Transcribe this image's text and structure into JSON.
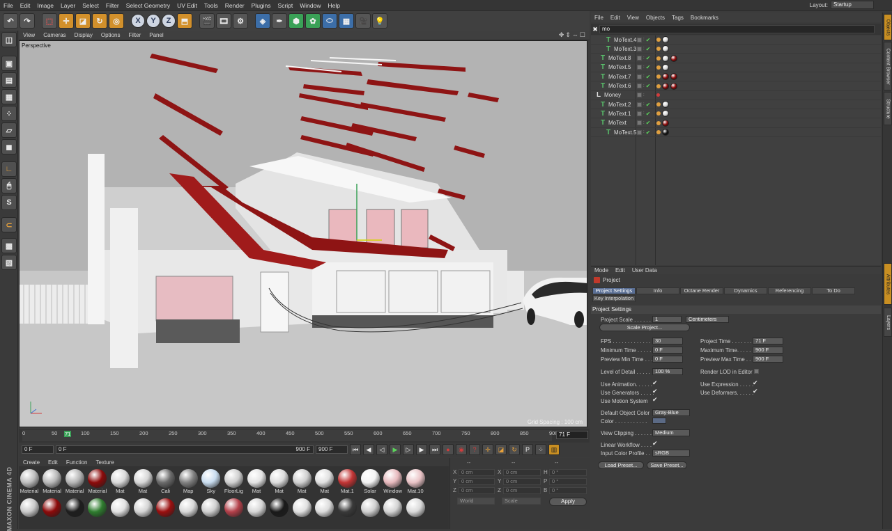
{
  "menubar": {
    "items": [
      "File",
      "Edit",
      "Image",
      "Layer",
      "Select",
      "Filter",
      "Select Geometry",
      "UV Edit",
      "Tools",
      "Render",
      "Plugins",
      "Script",
      "Window",
      "Help"
    ],
    "layout_label": "Layout:",
    "layout_value": "Startup"
  },
  "toolbar": {
    "axis_x": "X",
    "axis_y": "Y",
    "axis_z": "Z"
  },
  "leftpal": {
    "s_label": "S"
  },
  "brand": "MAXON CINEMA 4D",
  "viewport": {
    "menu": [
      "View",
      "Cameras",
      "Display",
      "Options",
      "Filter",
      "Panel"
    ],
    "nav_icons": "✥⇕⇔☐",
    "label": "Perspective",
    "grid_spacing": "Grid Spacing : 100 cm"
  },
  "timeline": {
    "ticks": [
      "0",
      "50",
      "100",
      "150",
      "200",
      "250",
      "300",
      "350",
      "400",
      "450",
      "500",
      "550",
      "600",
      "650",
      "700",
      "750",
      "800",
      "850",
      "900"
    ],
    "current_marker": "71",
    "frame_field": "71 F"
  },
  "transport": {
    "start": "0 F",
    "range_start": "0 F",
    "range_end": "900 F",
    "end": "900 F"
  },
  "materials": {
    "menu": [
      "Create",
      "Edit",
      "Function",
      "Texture"
    ],
    "row1": [
      {
        "label": "Material",
        "color": "#bdbdbd"
      },
      {
        "label": "Material",
        "color": "#b8b8b8"
      },
      {
        "label": "Material",
        "color": "#b5b5b5"
      },
      {
        "label": "Material",
        "color": "#8c0a0a"
      },
      {
        "label": "Mat",
        "color": "#d9d9d9"
      },
      {
        "label": "Mat",
        "color": "#d6d6d6"
      },
      {
        "label": "Cali",
        "color": "#6a6a6a"
      },
      {
        "label": "Map",
        "color": "#808080"
      },
      {
        "label": "Sky",
        "color": "#c8dcef"
      },
      {
        "label": "FloorLig",
        "color": "#cfcfcf"
      },
      {
        "label": "Mat",
        "color": "#e4e4e4"
      },
      {
        "label": "Mat",
        "color": "#dcdcdc"
      },
      {
        "label": "Mat",
        "color": "#d0d0d0"
      },
      {
        "label": "Mat",
        "color": "#e0e0e0"
      },
      {
        "label": "Mat.1",
        "color": "#c23434"
      },
      {
        "label": "Solar",
        "color": "#f2f2f2"
      },
      {
        "label": "Window",
        "color": "#e7b9bd"
      },
      {
        "label": "Mat.10",
        "color": "#e9c3c6"
      }
    ],
    "row2": [
      {
        "color": "#c9c9c9"
      },
      {
        "color": "#8c0a0a"
      },
      {
        "color": "#1e1e1e"
      },
      {
        "color": "#2f7d2f"
      },
      {
        "color": "#e1e1e1"
      },
      {
        "color": "#d4d4d4"
      },
      {
        "color": "#9a0f0f"
      },
      {
        "color": "#d8d8d8"
      },
      {
        "color": "#cfcfcf"
      },
      {
        "color": "#b3404a"
      },
      {
        "color": "#d6d6d6"
      },
      {
        "color": "#1a1a1a"
      },
      {
        "color": "#e0e0e0"
      },
      {
        "color": "#dcdcdc"
      },
      {
        "color": "#3a3a3a"
      },
      {
        "color": "#cfcfcf"
      },
      {
        "color": "#d3d3d3"
      },
      {
        "color": "#d9d9d9"
      }
    ]
  },
  "coords": {
    "headers": [
      "--",
      "--",
      "--"
    ],
    "rows": [
      {
        "a": "X",
        "av": "0 cm",
        "b": "X",
        "bv": "0 cm",
        "c": "H",
        "cv": "0 °"
      },
      {
        "a": "Y",
        "av": "0 cm",
        "b": "Y",
        "bv": "0 cm",
        "c": "P",
        "cv": "0 °"
      },
      {
        "a": "Z",
        "av": "0 cm",
        "b": "Z",
        "bv": "0 cm",
        "c": "B",
        "cv": "0 °"
      }
    ],
    "world": "World",
    "scale": "Scale",
    "apply": "Apply"
  },
  "objects": {
    "menu": [
      "File",
      "Edit",
      "View",
      "Objects",
      "Tags",
      "Bookmarks"
    ],
    "search_value": "mo",
    "rows": [
      {
        "name": "MoText.4",
        "indent": 22,
        "tag": "#d8d8d8",
        "extra": ""
      },
      {
        "name": "MoText.3",
        "indent": 22,
        "tag": "#d8d8d8",
        "extra": ""
      },
      {
        "name": "MoText.8",
        "indent": 14,
        "tag": "#d8d8d8",
        "extra": "#8c0a0a"
      },
      {
        "name": "MoText.5",
        "indent": 14,
        "tag": "#d8d8d8",
        "extra": ""
      },
      {
        "name": "MoText.7",
        "indent": 14,
        "tag": "#8c0a0a",
        "extra": "#8c0a0a"
      },
      {
        "name": "MoText.6",
        "indent": 14,
        "tag": "#8c0a0a",
        "extra": "#8c0a0a"
      },
      {
        "name": "Money",
        "indent": 8,
        "tag": "",
        "extra": ""
      },
      {
        "name": "MoText.2",
        "indent": 14,
        "tag": "#d8d8d8",
        "extra": ""
      },
      {
        "name": "MoText.1",
        "indent": 14,
        "tag": "#d8d8d8",
        "extra": ""
      },
      {
        "name": "MoText",
        "indent": 14,
        "tag": "#8c0a0a",
        "extra": ""
      },
      {
        "name": "MoText.5",
        "indent": 22,
        "tag": "#111111",
        "extra": ""
      }
    ]
  },
  "rtabs": [
    "Objects",
    "Content Browser",
    "Structure",
    "Attributes",
    "Layers"
  ],
  "attributes": {
    "menu": [
      "Mode",
      "Edit",
      "User Data"
    ],
    "title": "Project",
    "tabs": [
      "Project Settings",
      "Info",
      "Octane Render",
      "Dynamics",
      "Referencing",
      "To Do",
      "Key Interpolation"
    ],
    "section": "Project Settings",
    "project_scale_label": "Project Scale . . . . . .",
    "project_scale_value": "1",
    "project_scale_unit": "Centimeters",
    "scale_project_btn": "Scale Project...",
    "fps_label": "FPS . . . . . . . . . . . . . .",
    "fps_value": "30",
    "project_time_label": "Project Time . . . . . . .",
    "project_time_value": "71 F",
    "min_time_label": "Minimum Time . . . . . .",
    "min_time_value": "0 F",
    "max_time_label": "Maximum Time. . . . . .",
    "max_time_value": "900 F",
    "prev_min_label": "Preview Min Time . . .",
    "prev_min_value": "0 F",
    "prev_max_label": "Preview Max Time . . .",
    "prev_max_value": "900 F",
    "lod_label": "Level of Detail . . . . . .",
    "lod_value": "100 %",
    "render_lod_label": "Render LOD in Editor",
    "use_animation_label": "Use Animation. . . . . .",
    "use_expression_label": "Use Expression . . . . .",
    "use_generators_label": "Use Generators . . . . .",
    "use_deformers_label": "Use Deformers. . . . . .",
    "use_motion_label": "Use Motion System",
    "default_color_label": "Default Object Color",
    "default_color_value": "Gray-Blue",
    "color_label": "Color . . . . . . . . . . .",
    "view_clipping_label": "View Clipping . . . . . .",
    "view_clipping_value": "Medium",
    "linear_workflow_label": "Linear Workflow . . . .",
    "input_color_label": "Input Color Profile . . .",
    "input_color_value": "sRGB",
    "load_preset": "Load Preset...",
    "save_preset": "Save Preset..."
  },
  "colors": {
    "accent_orange": "#c98f22",
    "tab_active": "#5a6f95",
    "roof_red": "#8e1414",
    "viewport_bg": "#b3b3b3"
  }
}
